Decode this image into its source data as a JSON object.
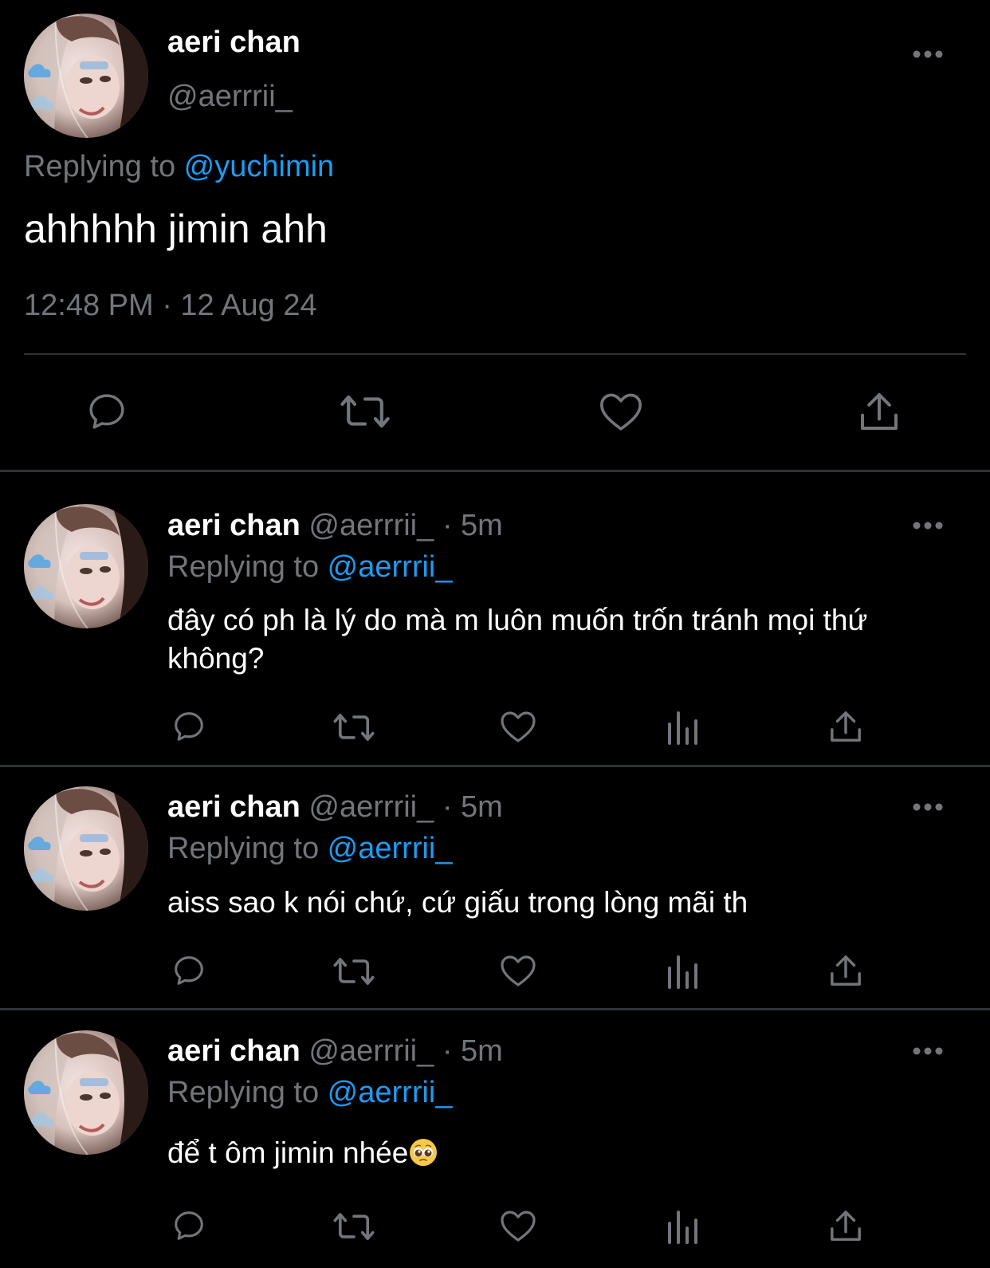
{
  "colors": {
    "background": "#000000",
    "primary_text": "#ffffff",
    "secondary_text": "#71767b",
    "accent": "#1d9bf0",
    "divider": "#2f3336",
    "icon": "#71767b"
  },
  "main_tweet": {
    "display_name": "aeri chan",
    "handle": "@aerrrii_",
    "replying_prefix": "Replying to ",
    "replying_to": "@yuchimin",
    "text": "ahhhhh jimin ahh",
    "timestamp": "12:48 PM · 12 Aug 24",
    "actions": [
      "reply-icon",
      "retweet-icon",
      "like-icon",
      "share-icon"
    ]
  },
  "replies": [
    {
      "display_name": "aeri chan",
      "meta": " @aerrrii_ · 5m",
      "replying_prefix": "Replying to ",
      "replying_to": "@aerrrii_",
      "text": "đây có ph là lý do mà m luôn muốn trốn tránh mọi thứ không?",
      "actions": [
        "reply-icon",
        "retweet-icon",
        "like-icon",
        "views-icon",
        "share-icon"
      ]
    },
    {
      "display_name": "aeri chan",
      "meta": " @aerrrii_ · 5m",
      "replying_prefix": "Replying to ",
      "replying_to": "@aerrrii_",
      "text": "aiss sao k nói chứ, cứ giấu trong lòng mãi th",
      "actions": [
        "reply-icon",
        "retweet-icon",
        "like-icon",
        "views-icon",
        "share-icon"
      ]
    },
    {
      "display_name": "aeri chan",
      "meta": " @aerrrii_ · 5m",
      "replying_prefix": "Replying to ",
      "replying_to": "@aerrrii_",
      "text": "để t ôm jimin nhée",
      "emoji": "pleading-face-emoji",
      "actions": [
        "reply-icon",
        "retweet-icon",
        "like-icon",
        "views-icon",
        "share-icon"
      ]
    }
  ]
}
